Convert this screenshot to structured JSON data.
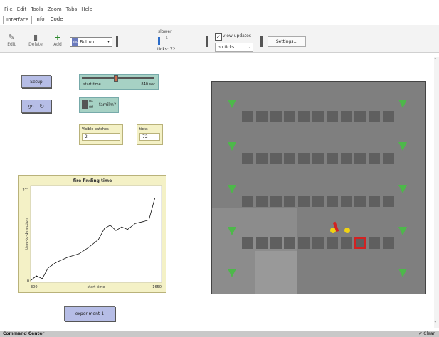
{
  "menu": [
    "File",
    "Edit",
    "Tools",
    "Zoom",
    "Tabs",
    "Help"
  ],
  "tabs": [
    "Interface",
    "Info",
    "Code"
  ],
  "toolbar": {
    "edit_label": "Edit",
    "delete_label": "Delete",
    "add_label": "Add",
    "widget_selected": "Button",
    "speed_label": "slower",
    "speed_tick": "1",
    "ticks_text": "ticks: 72",
    "view_updates_label": "view updates",
    "update_mode": "on ticks",
    "settings_label": "Settings..."
  },
  "widgets": {
    "setup_label": "Setup",
    "go_label": "go",
    "slider": {
      "name": "start-time",
      "value_text": "840 sec",
      "value": 840
    },
    "switch": {
      "label": "familm?",
      "on": "On",
      "off": "Off"
    },
    "monitor_patches": {
      "label": "Visible patches",
      "value": "2"
    },
    "monitor_ticks": {
      "label": "ticks",
      "value": "72"
    },
    "experiment_label": "experiment-1"
  },
  "plot": {
    "title": "fire finding time",
    "xlabel": "start-time",
    "ylabel": "time-to-detection",
    "xmin": "300",
    "xmax": "1650",
    "ymin": "0",
    "ymax": "271"
  },
  "chart_data": {
    "type": "line",
    "title": "fire finding time",
    "xlabel": "start-time",
    "ylabel": "time-to-detection",
    "xlim": [
      300,
      1650
    ],
    "ylim": [
      0,
      271
    ],
    "x": [
      300,
      360,
      420,
      480,
      560,
      680,
      800,
      900,
      1000,
      1060,
      1120,
      1180,
      1240,
      1300,
      1380,
      1460,
      1520,
      1580
    ],
    "y": [
      5,
      18,
      10,
      40,
      55,
      70,
      80,
      98,
      120,
      150,
      160,
      145,
      155,
      148,
      165,
      170,
      175,
      235
    ]
  },
  "colors": {
    "button": "#b6bde6",
    "slider": "#a6d1c4",
    "monitor": "#f4f1c6",
    "patch": "#7f7f7f",
    "arrow": "#4db84a",
    "target": "#d22222"
  },
  "command_center": {
    "label": "Command Center",
    "clear_label": "Clear"
  }
}
